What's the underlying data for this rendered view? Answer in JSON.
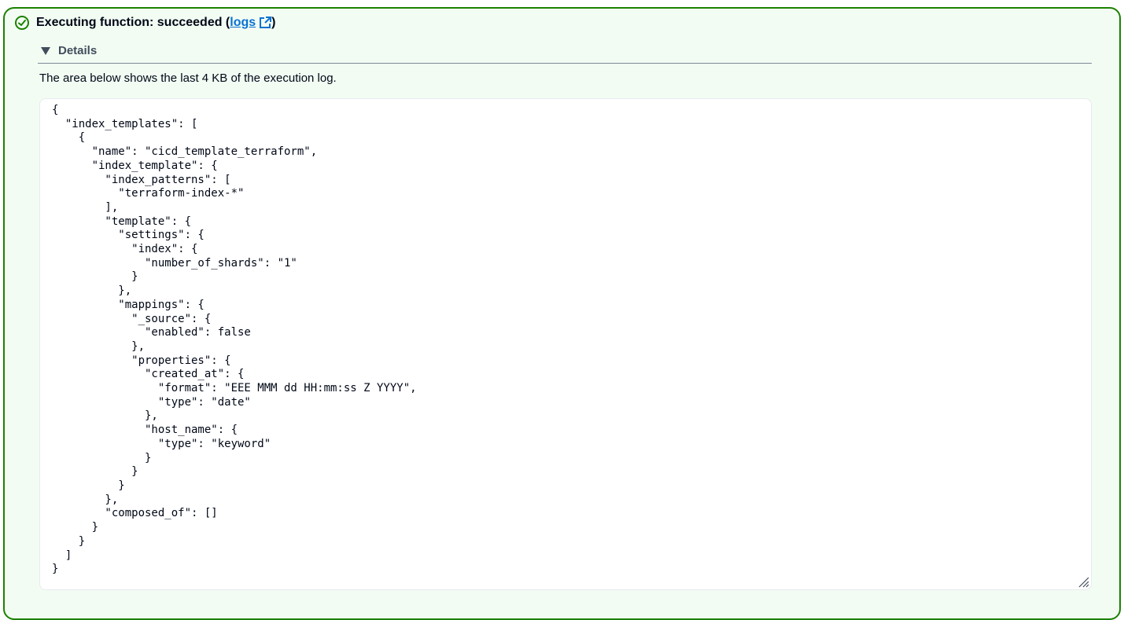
{
  "status": {
    "icon": "check-circle-icon",
    "color": "#1d8102",
    "prefix": "Executing function: succeeded (",
    "link_text": "logs",
    "link_icon": "external-link-icon",
    "suffix": ")"
  },
  "details": {
    "toggle_label": "Details",
    "expanded": true,
    "description": "The area below shows the last 4 KB of the execution log.",
    "log_text": "{\n  \"index_templates\": [\n    {\n      \"name\": \"cicd_template_terraform\",\n      \"index_template\": {\n        \"index_patterns\": [\n          \"terraform-index-*\"\n        ],\n        \"template\": {\n          \"settings\": {\n            \"index\": {\n              \"number_of_shards\": \"1\"\n            }\n          },\n          \"mappings\": {\n            \"_source\": {\n              \"enabled\": false\n            },\n            \"properties\": {\n              \"created_at\": {\n                \"format\": \"EEE MMM dd HH:mm:ss Z YYYY\",\n                \"type\": \"date\"\n              },\n              \"host_name\": {\n                \"type\": \"keyword\"\n              }\n            }\n          }\n        },\n        \"composed_of\": []\n      }\n    }\n  ]\n}"
  },
  "colors": {
    "accent_link": "#0972d3",
    "border": "#1d8102",
    "background": "#f2fcf3"
  }
}
